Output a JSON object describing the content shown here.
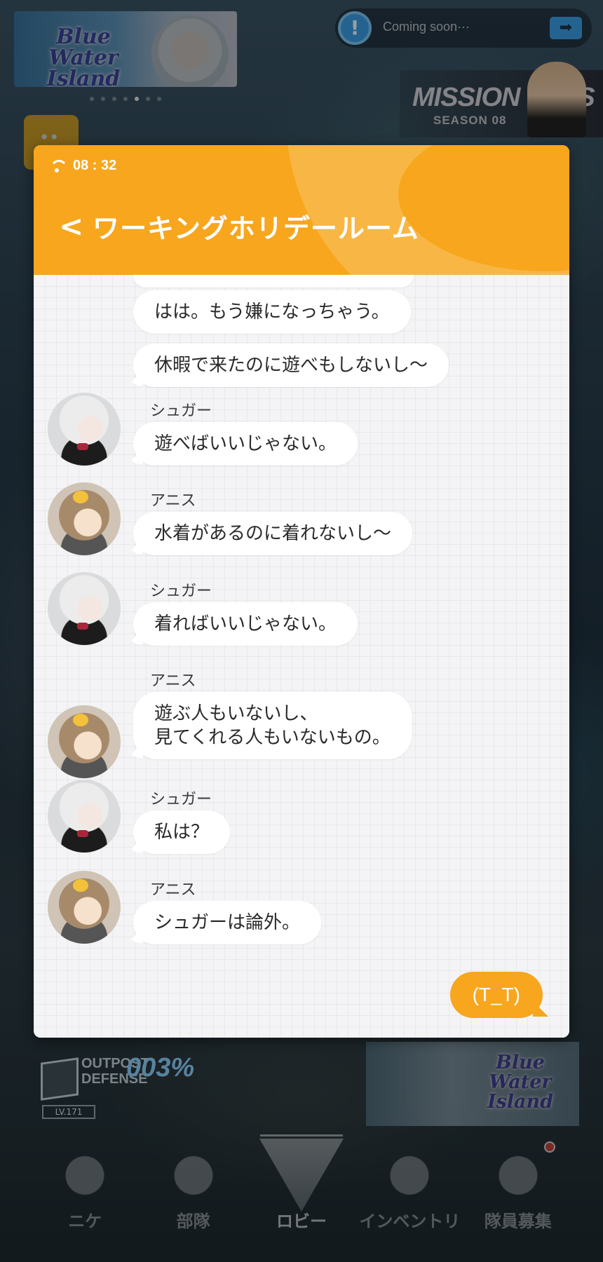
{
  "background": {
    "coming_soon_text": "Coming soon···",
    "banner_logo": "Blue Water Island",
    "mission_pass": {
      "title": "MISSION PASS",
      "season": "SEASON 08"
    },
    "outpost": {
      "name_line1": "OUTPOST",
      "name_line2": "DEFENSE",
      "percent": "003%",
      "level": "LV.171"
    },
    "event_logo": "Blue Water Island"
  },
  "chat": {
    "status_time": "08 : 32",
    "back_label": "<",
    "room_title": "ワーキングホリデールーム",
    "messages": [
      {
        "speaker": "",
        "text": "はは。もう嫌になっちゃう。"
      },
      {
        "speaker": "",
        "text": "休暇で来たのに遊べもしないし～"
      },
      {
        "speaker": "シュガー",
        "avatar": "sugar",
        "text": "遊べばいいじゃない。"
      },
      {
        "speaker": "アニス",
        "avatar": "anis",
        "text": "水着があるのに着れないし～"
      },
      {
        "speaker": "シュガー",
        "avatar": "sugar",
        "text": "着ればいいじゃない。"
      },
      {
        "speaker": "アニス",
        "avatar": "anis",
        "text_line1": "遊ぶ人もいないし、",
        "text_line2": "見てくれる人もいないもの。"
      },
      {
        "speaker": "シュガー",
        "avatar": "sugar",
        "text": "私は？"
      },
      {
        "speaker": "アニス",
        "avatar": "anis",
        "text": "シュガーは論外。"
      }
    ],
    "reply": "(T_T)"
  },
  "nav": [
    {
      "label": "ニケ",
      "icon": "nikke-icon"
    },
    {
      "label": "部隊",
      "icon": "squad-icon"
    },
    {
      "label": "ロビー",
      "icon": "lobby-icon",
      "active": true
    },
    {
      "label": "インベントリ",
      "icon": "inventory-icon"
    },
    {
      "label": "隊員募集",
      "icon": "recruit-icon",
      "badge": true
    }
  ],
  "colors": {
    "accent": "#f7a61d",
    "bubble": "#ffffff",
    "chat_bg": "#f4f4f6"
  }
}
